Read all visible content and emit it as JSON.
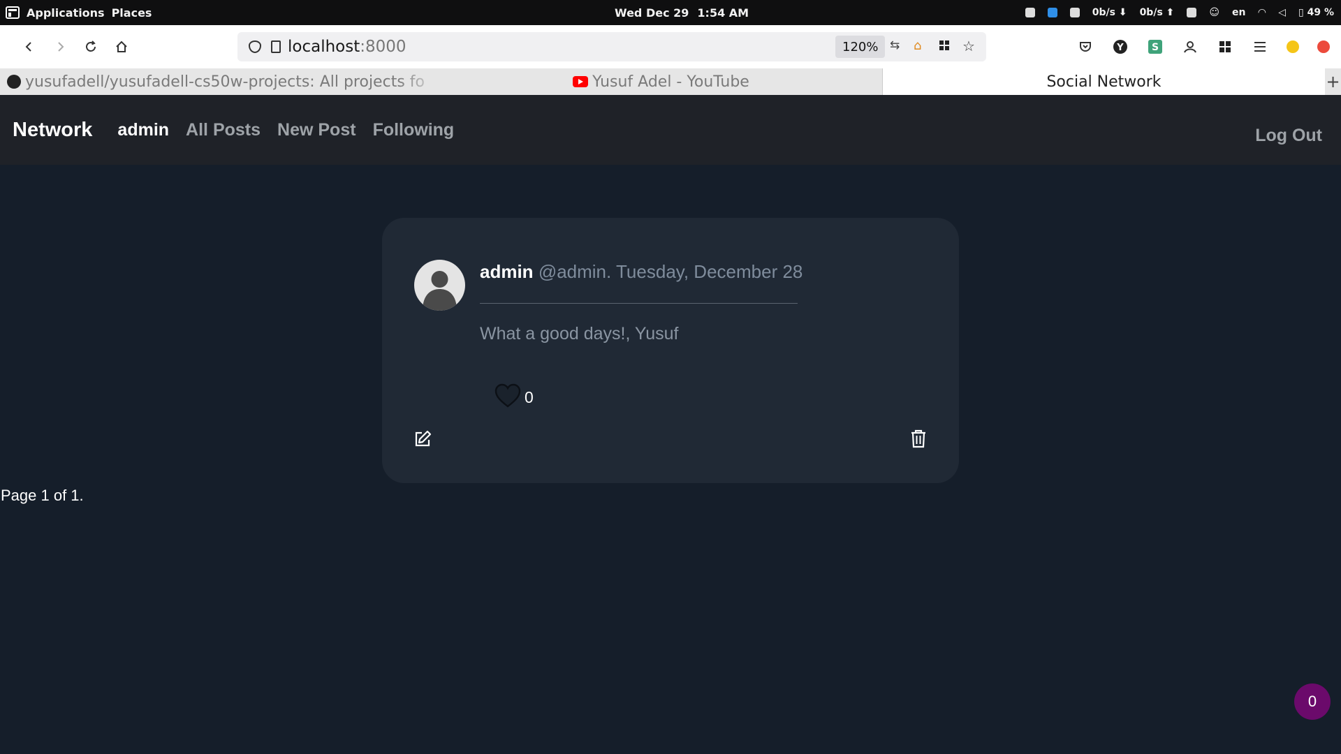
{
  "os_bar": {
    "applications": "Applications",
    "places": "Places",
    "date": "Wed Dec 29",
    "time": "1:54 AM",
    "net_down": "0b/s",
    "net_up": "0b/s",
    "lang": "en",
    "battery": "49 %"
  },
  "browser": {
    "url_host": "localhost",
    "url_port": ":8000",
    "zoom": "120%",
    "tabs": [
      {
        "label": "yusufadell/yusufadell-cs50w-projects: All projects fo"
      },
      {
        "label": "Yusuf Adel - YouTube"
      },
      {
        "label": "Social Network"
      }
    ]
  },
  "navbar": {
    "brand": "Network",
    "user": "admin",
    "all_posts": "All Posts",
    "new_post": "New Post",
    "following": "Following",
    "logout": "Log Out"
  },
  "post": {
    "author": "admin",
    "handle": "@admin.",
    "date": "Tuesday, December 28",
    "content": "What a good days!, Yusuf",
    "likes": "0"
  },
  "pagination": {
    "text": "Page 1 of 1."
  },
  "badge": {
    "count": "0"
  }
}
